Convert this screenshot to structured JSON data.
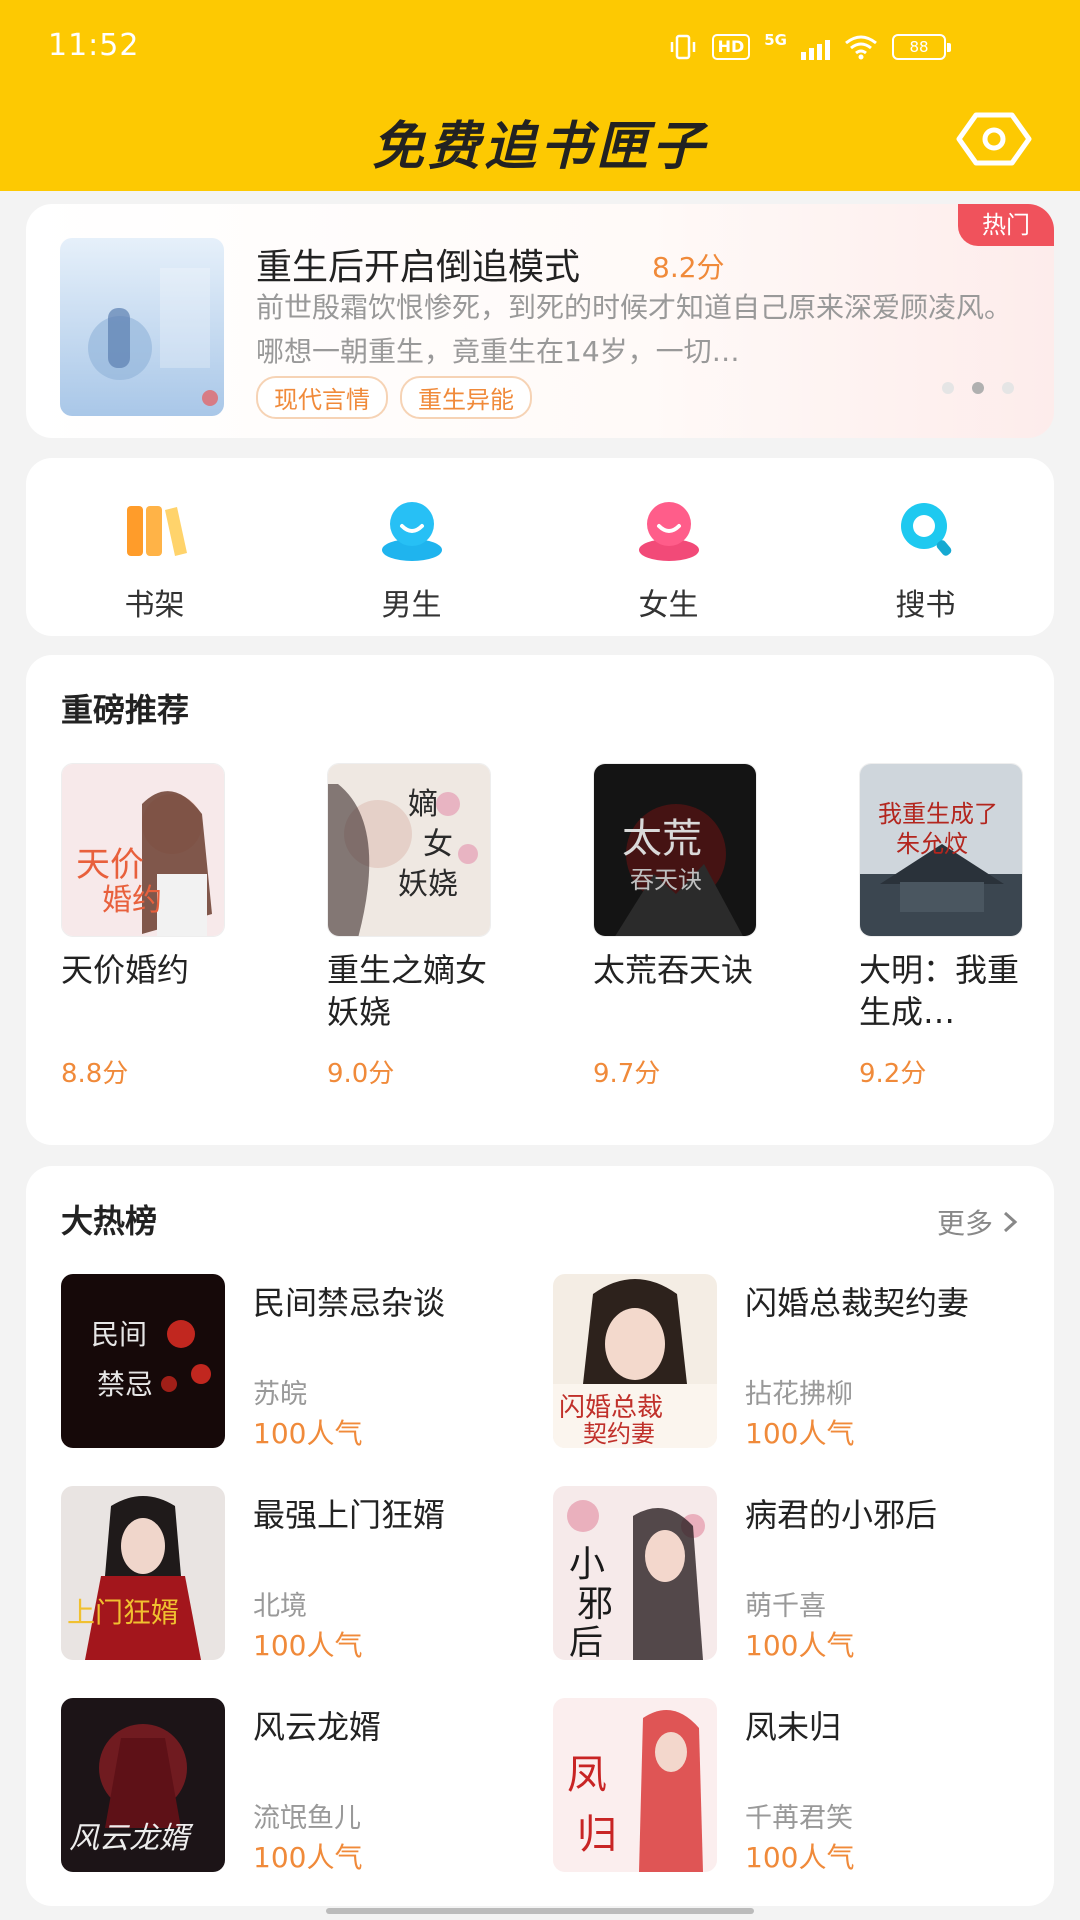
{
  "status_bar": {
    "time": "11:52",
    "hd": "HD",
    "network": "5G",
    "battery": "88"
  },
  "header": {
    "title": "免费追书匣子"
  },
  "banner": {
    "title": "重生后开启倒追模式",
    "score": "8.2分",
    "description": "前世殷霜饮恨惨死，到死的时候才知道自己原来深爱顾凌风。哪想一朝重生，竟重生在14岁，一切…",
    "tags": [
      "现代言情",
      "重生异能"
    ],
    "badge": "热门"
  },
  "nav": [
    {
      "label": "书架",
      "icon": "bookshelf-icon"
    },
    {
      "label": "男生",
      "icon": "male-icon"
    },
    {
      "label": "女生",
      "icon": "female-icon"
    },
    {
      "label": "搜书",
      "icon": "search-icon"
    }
  ],
  "recommend": {
    "title": "重磅推荐",
    "books": [
      {
        "name": "天价婚约",
        "score": "8.8分"
      },
      {
        "name": "重生之嫡女妖娆",
        "score": "9.0分"
      },
      {
        "name": "太荒吞天诀",
        "score": "9.7分"
      },
      {
        "name": "大明：我重生成…",
        "score": "9.2分"
      }
    ]
  },
  "hot_list": {
    "title": "大热榜",
    "more": "更多",
    "books": [
      {
        "name": "民间禁忌杂谈",
        "author": "苏皖",
        "popularity": "100人气"
      },
      {
        "name": "闪婚总裁契约妻",
        "author": "拈花拂柳",
        "popularity": "100人气"
      },
      {
        "name": "最强上门狂婿",
        "author": "北境",
        "popularity": "100人气"
      },
      {
        "name": "病君的小邪后",
        "author": "萌千喜",
        "popularity": "100人气"
      },
      {
        "name": "风云龙婿",
        "author": "流氓鱼儿",
        "popularity": "100人气"
      },
      {
        "name": "凤未归",
        "author": "千苒君笑",
        "popularity": "100人气"
      }
    ]
  },
  "colors": {
    "brand": "#fdc902",
    "accent": "#f08a3a",
    "badge": "#f0525c"
  }
}
